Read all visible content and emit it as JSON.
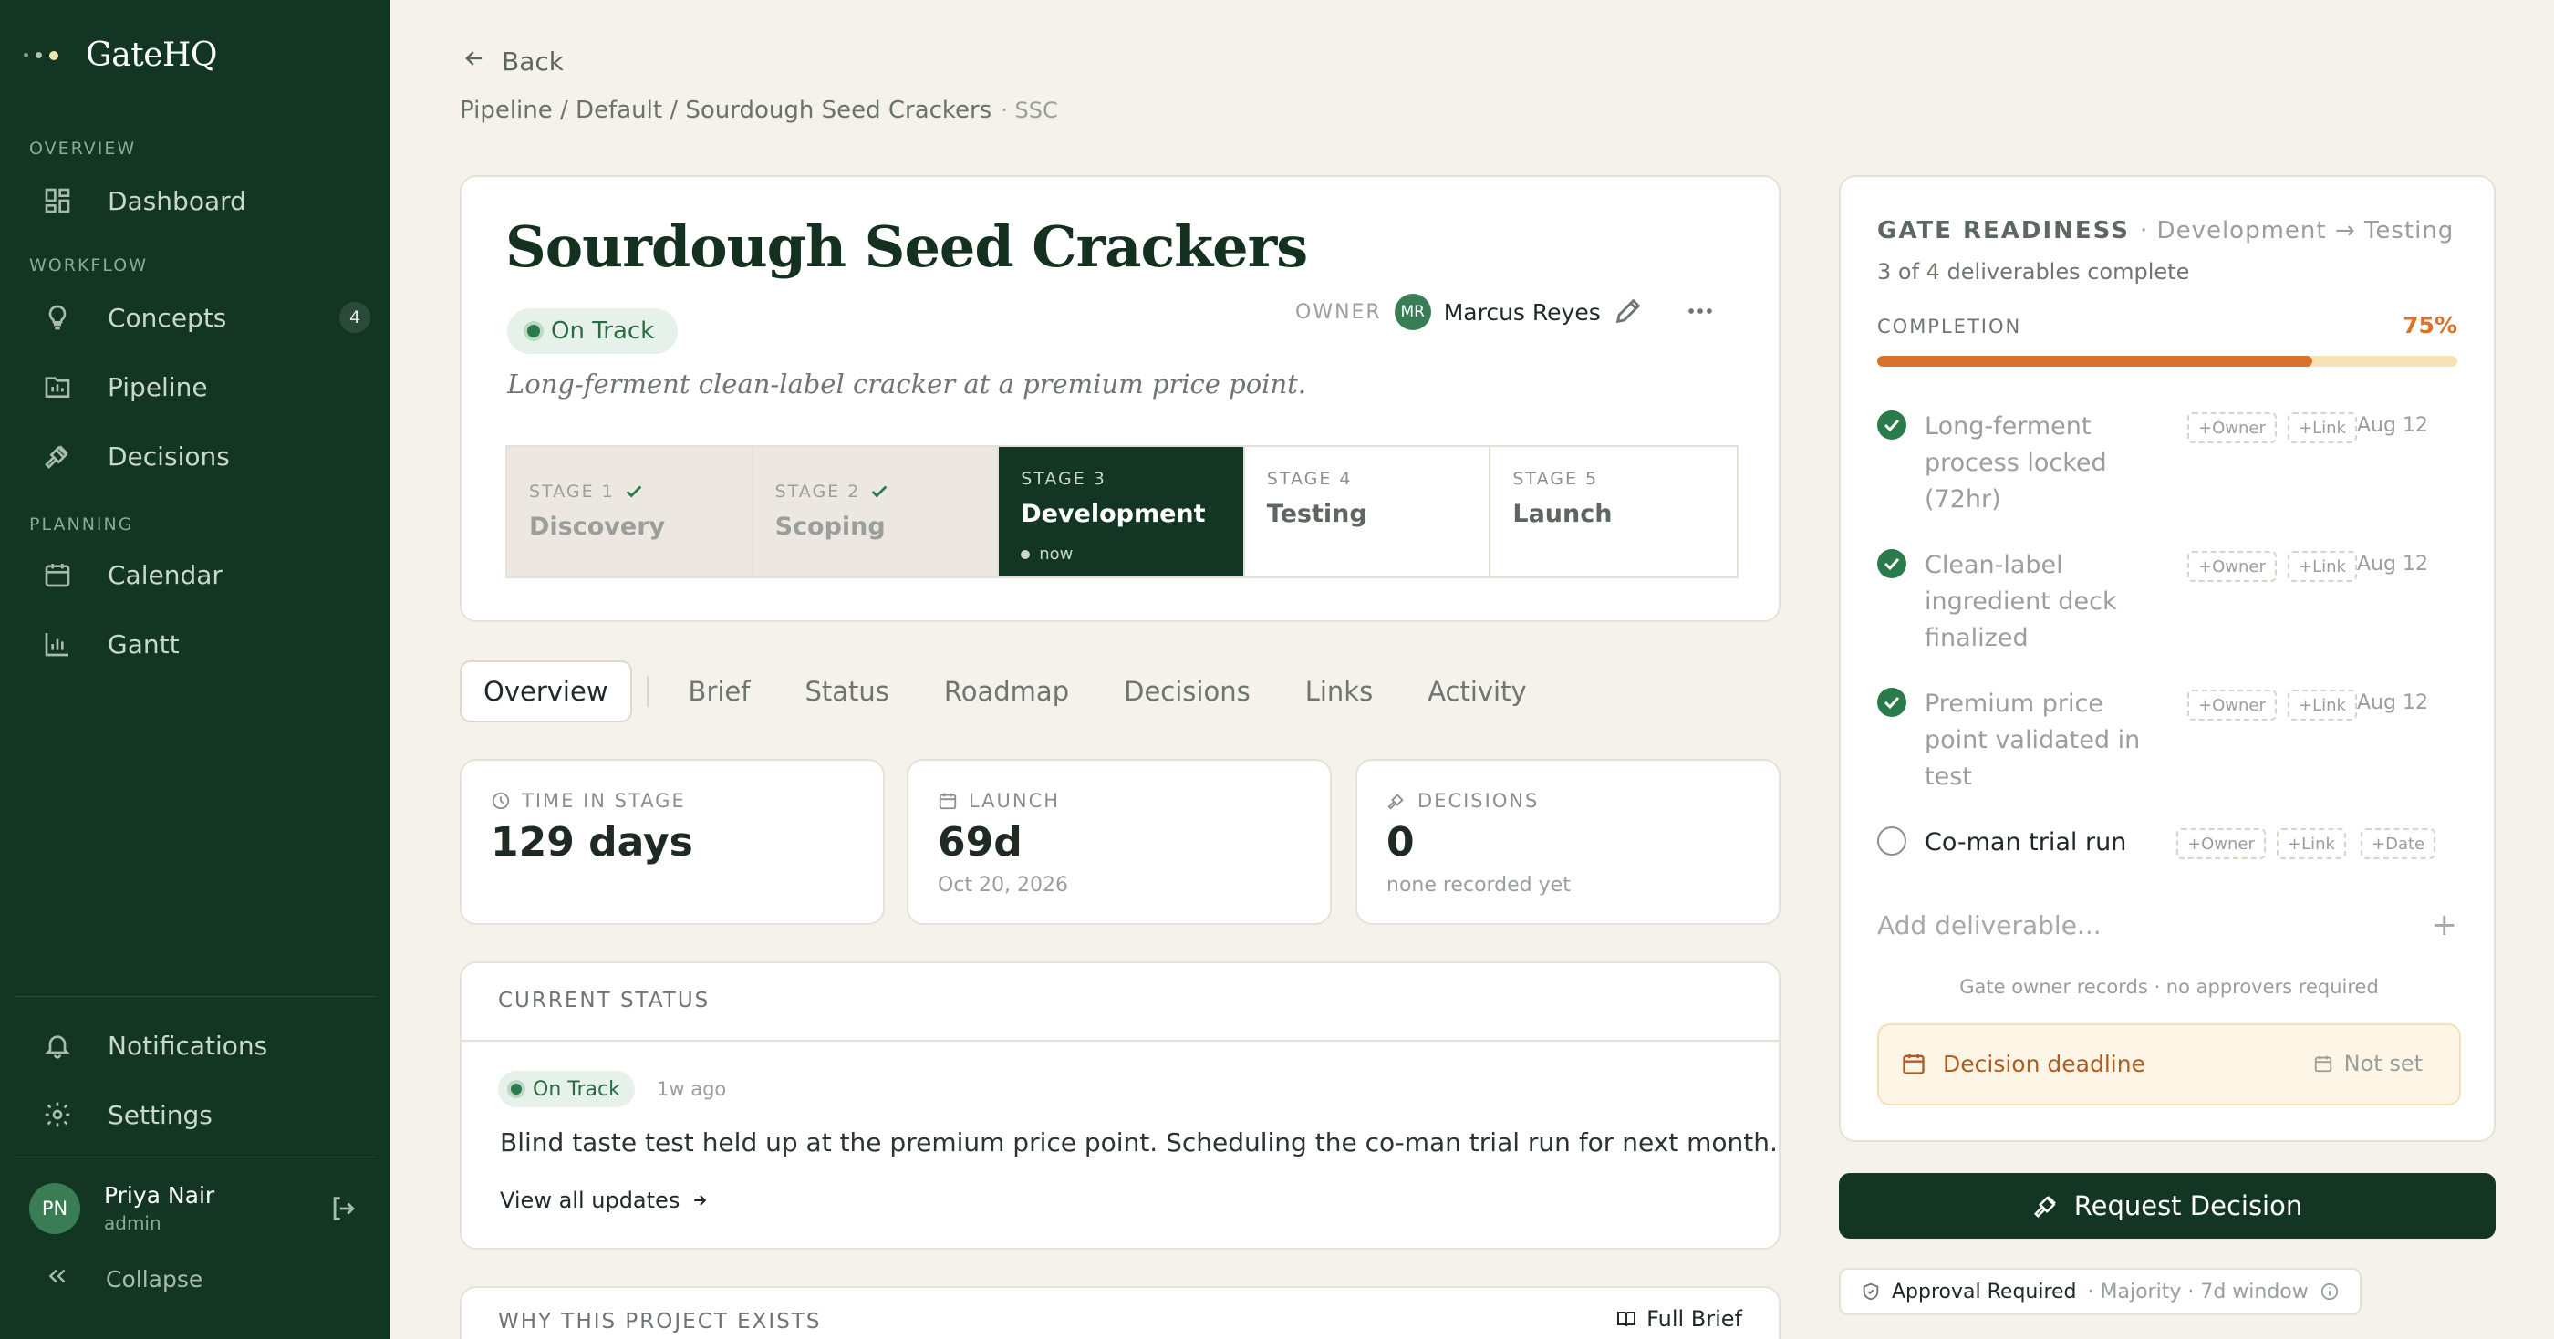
{
  "app": {
    "name": "GateHQ"
  },
  "sidebar": {
    "sections": [
      {
        "label": "OVERVIEW",
        "items": [
          {
            "label": "Dashboard",
            "icon": "dashboard-icon"
          }
        ]
      },
      {
        "label": "WORKFLOW",
        "items": [
          {
            "label": "Concepts",
            "icon": "lightbulb-icon",
            "badge": "4"
          },
          {
            "label": "Pipeline",
            "icon": "pipeline-icon"
          },
          {
            "label": "Decisions",
            "icon": "gavel-icon"
          }
        ]
      },
      {
        "label": "PLANNING",
        "items": [
          {
            "label": "Calendar",
            "icon": "calendar-icon"
          },
          {
            "label": "Gantt",
            "icon": "bar-chart-icon"
          }
        ]
      }
    ],
    "bottom": {
      "notifications": "Notifications",
      "settings": "Settings",
      "collapse": "Collapse"
    },
    "user": {
      "initials": "PN",
      "name": "Priya Nair",
      "role": "admin"
    }
  },
  "nav": {
    "back": "Back",
    "breadcrumb": "Pipeline / Default / Sourdough Seed Crackers",
    "code": "· SSC"
  },
  "project": {
    "title": "Sourdough Seed Crackers",
    "status": "On Track",
    "owner_label": "OWNER",
    "owner_initials": "MR",
    "owner_name": "Marcus Reyes",
    "subtitle": "Long-ferment clean-label cracker at a premium price point.",
    "stages": [
      {
        "label": "STAGE 1",
        "name": "Discovery",
        "state": "done"
      },
      {
        "label": "STAGE 2",
        "name": "Scoping",
        "state": "done"
      },
      {
        "label": "STAGE 3",
        "name": "Development",
        "state": "current",
        "now": "now"
      },
      {
        "label": "STAGE 4",
        "name": "Testing",
        "state": "future"
      },
      {
        "label": "STAGE 5",
        "name": "Launch",
        "state": "future"
      }
    ]
  },
  "tabs": [
    "Overview",
    "Brief",
    "Status",
    "Roadmap",
    "Decisions",
    "Links",
    "Activity"
  ],
  "stats": [
    {
      "label": "TIME IN STAGE",
      "icon": "clock-icon",
      "value": "129 days",
      "sub": ""
    },
    {
      "label": "LAUNCH",
      "icon": "calendar-icon",
      "value": "69d",
      "sub": "Oct 20, 2026"
    },
    {
      "label": "DECISIONS",
      "icon": "gavel-icon",
      "value": "0",
      "sub": "none recorded yet"
    }
  ],
  "current_status": {
    "heading": "CURRENT STATUS",
    "pill": "On Track",
    "ago": "1w ago",
    "text": "Blind taste test held up at the premium price point. Scheduling the co-man trial run for next month.",
    "link": "View all updates"
  },
  "why": {
    "heading": "WHY THIS PROJECT EXISTS",
    "link": "Full Brief"
  },
  "gate": {
    "title": "GATE READINESS",
    "transition": "· Development → Testing",
    "summary": "3 of 4 deliverables complete",
    "completion_label": "COMPLETION",
    "completion_pct_text": "75%",
    "completion_fraction": 0.75,
    "deliverables": [
      {
        "name": "Long-ferment process locked (72hr)",
        "done": true,
        "owner_tag": "+Owner",
        "link_tag": "+Link",
        "date": "Aug 12"
      },
      {
        "name": "Clean-label ingredient deck finalized",
        "done": true,
        "owner_tag": "+Owner",
        "link_tag": "+Link",
        "date": "Aug 12"
      },
      {
        "name": "Premium price point validated in test",
        "done": true,
        "owner_tag": "+Owner",
        "link_tag": "+Link",
        "date": "Aug 12"
      },
      {
        "name": "Co-man trial run",
        "done": false,
        "owner_tag": "+Owner",
        "link_tag": "+Link",
        "date_tag": "+Date"
      }
    ],
    "add_placeholder": "Add deliverable...",
    "note": "Gate owner records · no approvers required",
    "deadline_label": "Decision deadline",
    "deadline_value": "Not set"
  },
  "actions": {
    "request": "Request Decision"
  },
  "approval": {
    "label": "Approval Required",
    "detail": "· Majority · 7d window"
  },
  "colors": {
    "sidebar": "#123524",
    "accent_orange": "#d9732c",
    "success": "#2b7a4b",
    "background": "#f5f2ec"
  }
}
